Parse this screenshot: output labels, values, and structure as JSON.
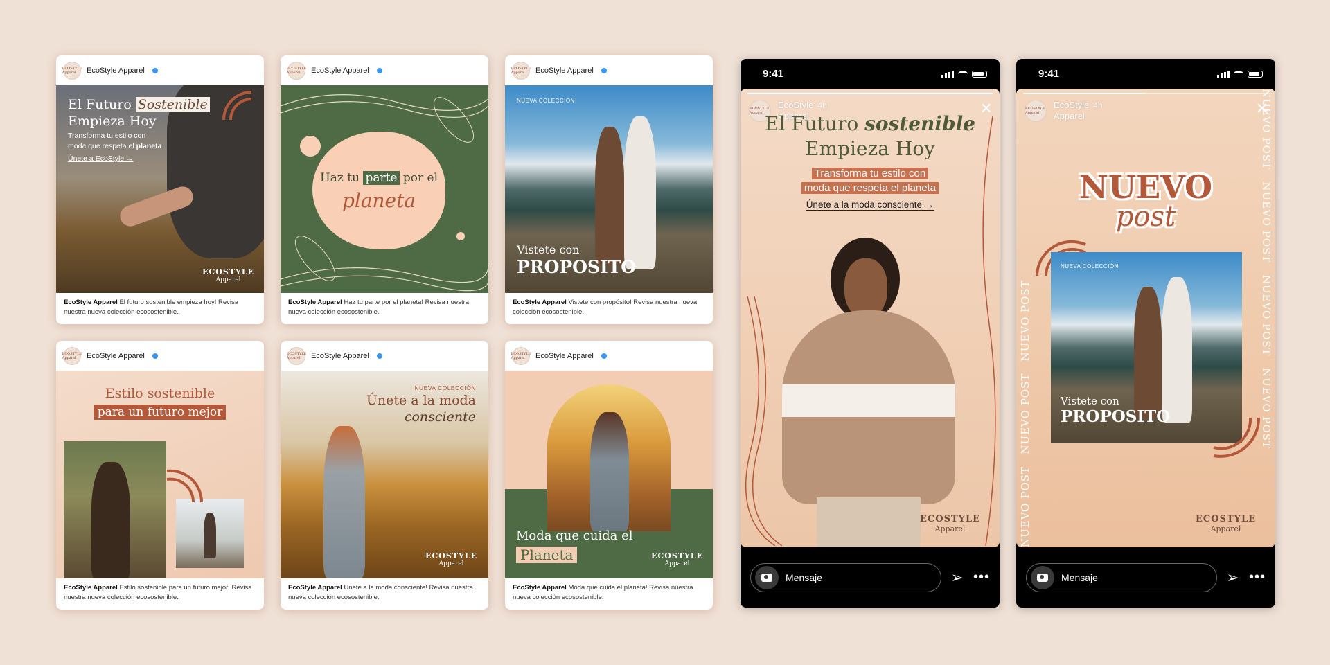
{
  "account": {
    "name": "EcoStyle Apparel",
    "avatar_text": "ECOSTYLE Apparel"
  },
  "brand": {
    "name": "ECOSTYLE",
    "sub": "Apparel"
  },
  "posts": [
    {
      "headline_1": "El Futuro ",
      "headline_em": "Sostenible",
      "headline_2": "Empieza Hoy",
      "body_1": "Transforma tu estilo con",
      "body_2a": "moda que respeta el ",
      "body_2b": "planeta",
      "cta": "Únete a EcoStyle →",
      "caption": "El futuro sostenible empieza hoy! Revisa nuestra nueva colección ecosostenible."
    },
    {
      "line_a": "Haz tu ",
      "line_hl": "parte",
      "line_b": " por el",
      "line_c": "planeta",
      "caption": "Haz tu parte por el planeta! Revisa nuestra nueva colección ecosostenible."
    },
    {
      "tag": "NUEVA COLECCIÓN",
      "line_1": "Vistete con",
      "line_2": "PROPOSITO",
      "caption": "Vistete con propósito! Revisa nuestra nueva colección ecosostenible."
    },
    {
      "line_1": "Estilo sostenible",
      "line_2": "para un futuro mejor",
      "caption": "Estilo sostenible para un futuro mejor! Revisa nuestra nueva colección ecosostenible."
    },
    {
      "tag": "NUEVA COLECCIÓN",
      "line_1": "Únete a la moda",
      "line_2": "consciente",
      "caption": "Unete a la moda consciente! Revisa nuestra nueva colección ecosostenible."
    },
    {
      "line_1": "Moda que cuida el",
      "line_2": "Planeta",
      "caption": "Moda que cuida el planeta! Revisa nuestra nueva colección ecosostenible."
    }
  ],
  "stories": [
    {
      "time_status": "9:41",
      "user_1": "EcoStyle",
      "user_2": "Apparel",
      "time": "4h",
      "headline_1": "El Futuro ",
      "headline_em": "sostenible",
      "headline_2": "Empieza Hoy",
      "sub_1": "Transforma tu estilo con",
      "sub_2": "moda que respeta el planeta",
      "cta": "Únete a la moda consciente →",
      "message_placeholder": "Mensaje"
    },
    {
      "time_status": "9:41",
      "user_1": "EcoStyle",
      "user_2": "Apparel",
      "time": "4h",
      "big_1": "NUEVO",
      "big_2": "post",
      "tag": "NUEVA COLECCIÓN",
      "line_1": "Vistete con",
      "line_2": "PROPOSITO",
      "side_text": "NUEVO POST",
      "message_placeholder": "Mensaje"
    }
  ],
  "colors": {
    "background": "#f0e1d6",
    "terracotta": "#b4583a",
    "forest": "#4f6b45",
    "peach": "#f9cfb5"
  }
}
